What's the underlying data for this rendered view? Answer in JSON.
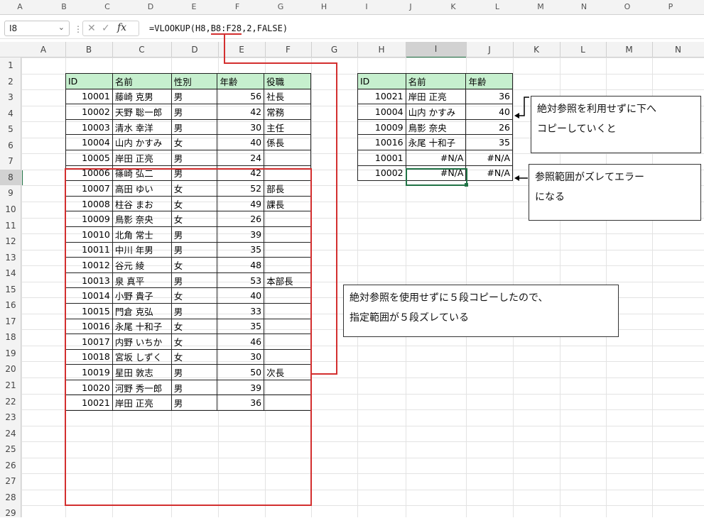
{
  "outer_columns": [
    "A",
    "B",
    "C",
    "D",
    "E",
    "F",
    "G",
    "H",
    "I",
    "J",
    "K",
    "L",
    "M",
    "N",
    "O",
    "P"
  ],
  "name_box": "I8",
  "formula_prefix": "=VLOOKUP(H8,",
  "formula_range": "B8:F28",
  "formula_suffix": ",2,FALSE)",
  "col_headers": [
    "A",
    "B",
    "C",
    "D",
    "E",
    "F",
    "G",
    "H",
    "I",
    "J",
    "K",
    "L",
    "M",
    "N"
  ],
  "row_numbers": [
    "1",
    "2",
    "3",
    "4",
    "5",
    "6",
    "7",
    "8",
    "9",
    "10",
    "11",
    "12",
    "13",
    "14",
    "15",
    "16",
    "17",
    "18",
    "19",
    "20",
    "21",
    "22",
    "23",
    "24",
    "25",
    "26",
    "27",
    "28",
    "29"
  ],
  "main_table": {
    "headers": [
      "ID",
      "名前",
      "性別",
      "年齢",
      "役職"
    ],
    "rows": [
      [
        "10001",
        "藤崎 克男",
        "男",
        "56",
        "社長"
      ],
      [
        "10002",
        "天野 聡一郎",
        "男",
        "42",
        "常務"
      ],
      [
        "10003",
        "清水 幸洋",
        "男",
        "30",
        "主任"
      ],
      [
        "10004",
        "山内 かすみ",
        "女",
        "40",
        "係長"
      ],
      [
        "10005",
        "岸田 正亮",
        "男",
        "24",
        ""
      ],
      [
        "10006",
        "篠崎 弘二",
        "男",
        "42",
        ""
      ],
      [
        "10007",
        "高田 ゆい",
        "女",
        "52",
        "部長"
      ],
      [
        "10008",
        "柱谷 まお",
        "女",
        "49",
        "課長"
      ],
      [
        "10009",
        "鳥影 奈央",
        "女",
        "26",
        ""
      ],
      [
        "10010",
        "北角 常士",
        "男",
        "39",
        ""
      ],
      [
        "10011",
        "中川 年男",
        "男",
        "35",
        ""
      ],
      [
        "10012",
        "谷元 綾",
        "女",
        "48",
        ""
      ],
      [
        "10013",
        "泉 真平",
        "男",
        "53",
        "本部長"
      ],
      [
        "10014",
        "小野 貴子",
        "女",
        "40",
        ""
      ],
      [
        "10015",
        "門倉 克弘",
        "男",
        "33",
        ""
      ],
      [
        "10016",
        "永尾 十和子",
        "女",
        "35",
        ""
      ],
      [
        "10017",
        "内野 いちか",
        "女",
        "46",
        ""
      ],
      [
        "10018",
        "宮坂 しずく",
        "女",
        "30",
        ""
      ],
      [
        "10019",
        "星田 敦志",
        "男",
        "50",
        "次長"
      ],
      [
        "10020",
        "河野 秀一郎",
        "男",
        "39",
        ""
      ],
      [
        "10021",
        "岸田 正亮",
        "男",
        "36",
        ""
      ]
    ]
  },
  "lookup_table": {
    "headers": [
      "ID",
      "名前",
      "年齢"
    ],
    "rows": [
      [
        "10021",
        "岸田 正亮",
        "36"
      ],
      [
        "10004",
        "山内 かすみ",
        "40"
      ],
      [
        "10009",
        "鳥影 奈央",
        "26"
      ],
      [
        "10016",
        "永尾 十和子",
        "35"
      ],
      [
        "10001",
        "#N/A",
        "#N/A"
      ],
      [
        "10002",
        "#N/A",
        "#N/A"
      ]
    ]
  },
  "callouts": {
    "copy_down": [
      "絶対参照を利用せずに下へ",
      "コピーしていくと"
    ],
    "range_shift": [
      "参照範囲がズレてエラー",
      "になる"
    ],
    "five_rows": [
      "絶対参照を使用せずに５段コピーしたので、",
      "指定範囲が５段ズレている"
    ]
  },
  "colors": {
    "header_fill": "#c6efce",
    "highlight": "#d32f2f",
    "selected": "#217346"
  }
}
